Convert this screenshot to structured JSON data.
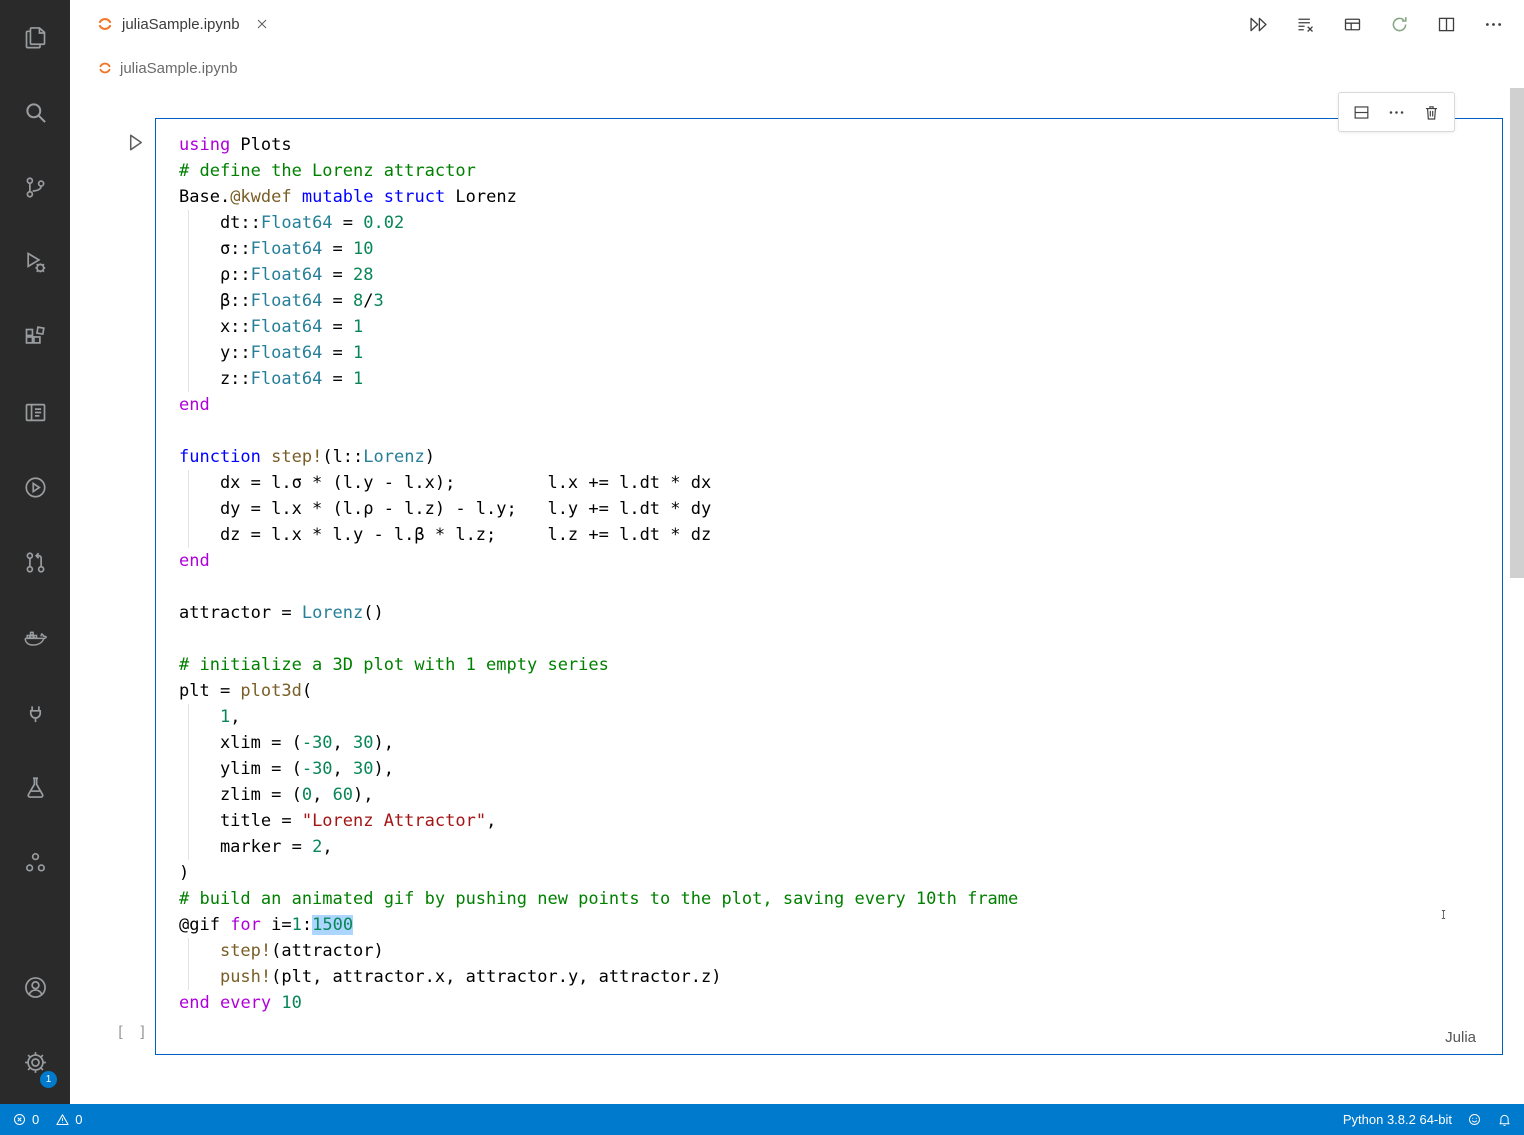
{
  "activity_bar": {
    "top_items": [
      "explorer",
      "search",
      "source-control",
      "run-debug",
      "extensions",
      "notebook",
      "run-circle",
      "pull-request",
      "docker",
      "remote",
      "test-flask",
      "organization"
    ],
    "bottom_items": [
      "account",
      "settings"
    ],
    "settings_badge": "1"
  },
  "tab_bar": {
    "tab": {
      "icon": "jupyter",
      "title": "juliaSample.ipynb"
    },
    "actions": [
      "run-all",
      "clear-outputs",
      "variables",
      "restart",
      "split-editor",
      "more-actions"
    ]
  },
  "breadcrumb": {
    "icon": "jupyter",
    "file": "juliaSample.ipynb"
  },
  "notebook": {
    "cell": {
      "toolbar": [
        "split-cell",
        "more-actions",
        "delete"
      ],
      "execution_count": "[ ]",
      "language": "Julia",
      "code_lines": [
        [
          [
            "k",
            "using"
          ],
          [
            "pl",
            " Plots"
          ]
        ],
        [
          [
            "co",
            "# define the Lorenz attractor"
          ]
        ],
        [
          [
            "pl",
            "Base."
          ],
          [
            "fn",
            "@kwdef"
          ],
          [
            "pl",
            " "
          ],
          [
            "kb",
            "mutable"
          ],
          [
            "pl",
            " "
          ],
          [
            "kb",
            "struct"
          ],
          [
            "pl",
            " Lorenz"
          ]
        ],
        [
          [
            "pl",
            "    dt::"
          ],
          [
            "ty",
            "Float64"
          ],
          [
            "pl",
            " = "
          ],
          [
            "nu",
            "0.02"
          ]
        ],
        [
          [
            "pl",
            "    σ::"
          ],
          [
            "ty",
            "Float64"
          ],
          [
            "pl",
            " = "
          ],
          [
            "nu",
            "10"
          ]
        ],
        [
          [
            "pl",
            "    ρ::"
          ],
          [
            "ty",
            "Float64"
          ],
          [
            "pl",
            " = "
          ],
          [
            "nu",
            "28"
          ]
        ],
        [
          [
            "pl",
            "    β::"
          ],
          [
            "ty",
            "Float64"
          ],
          [
            "pl",
            " = "
          ],
          [
            "nu",
            "8"
          ],
          [
            "pl",
            "/"
          ],
          [
            "nu",
            "3"
          ]
        ],
        [
          [
            "pl",
            "    x::"
          ],
          [
            "ty",
            "Float64"
          ],
          [
            "pl",
            " = "
          ],
          [
            "nu",
            "1"
          ]
        ],
        [
          [
            "pl",
            "    y::"
          ],
          [
            "ty",
            "Float64"
          ],
          [
            "pl",
            " = "
          ],
          [
            "nu",
            "1"
          ]
        ],
        [
          [
            "pl",
            "    z::"
          ],
          [
            "ty",
            "Float64"
          ],
          [
            "pl",
            " = "
          ],
          [
            "nu",
            "1"
          ]
        ],
        [
          [
            "k",
            "end"
          ]
        ],
        [],
        [
          [
            "kb",
            "function"
          ],
          [
            "pl",
            " "
          ],
          [
            "fn",
            "step!"
          ],
          [
            "pl",
            "(l::"
          ],
          [
            "ty",
            "Lorenz"
          ],
          [
            "pl",
            ")"
          ]
        ],
        [
          [
            "pl",
            "    dx = l.σ * (l.y - l.x);         l.x += l.dt * dx"
          ]
        ],
        [
          [
            "pl",
            "    dy = l.x * (l.ρ - l.z) - l.y;   l.y += l.dt * dy"
          ]
        ],
        [
          [
            "pl",
            "    dz = l.x * l.y - l.β * l.z;     l.z += l.dt * dz"
          ]
        ],
        [
          [
            "k",
            "end"
          ]
        ],
        [],
        [
          [
            "pl",
            "attractor = "
          ],
          [
            "ty",
            "Lorenz"
          ],
          [
            "pl",
            "()"
          ]
        ],
        [],
        [
          [
            "co",
            "# initialize a 3D plot with 1 empty series"
          ]
        ],
        [
          [
            "pl",
            "plt = "
          ],
          [
            "fn",
            "plot3d"
          ],
          [
            "pl",
            "("
          ]
        ],
        [
          [
            "pl",
            "    "
          ],
          [
            "nu",
            "1"
          ],
          [
            "pl",
            ","
          ]
        ],
        [
          [
            "pl",
            "    xlim = ("
          ],
          [
            "nu",
            "-30"
          ],
          [
            "pl",
            ", "
          ],
          [
            "nu",
            "30"
          ],
          [
            "pl",
            "),"
          ]
        ],
        [
          [
            "pl",
            "    ylim = ("
          ],
          [
            "nu",
            "-30"
          ],
          [
            "pl",
            ", "
          ],
          [
            "nu",
            "30"
          ],
          [
            "pl",
            "),"
          ]
        ],
        [
          [
            "pl",
            "    zlim = ("
          ],
          [
            "nu",
            "0"
          ],
          [
            "pl",
            ", "
          ],
          [
            "nu",
            "60"
          ],
          [
            "pl",
            "),"
          ]
        ],
        [
          [
            "pl",
            "    title = "
          ],
          [
            "st",
            "\"Lorenz Attractor\""
          ],
          [
            "pl",
            ","
          ]
        ],
        [
          [
            "pl",
            "    marker = "
          ],
          [
            "nu",
            "2"
          ],
          [
            "pl",
            ","
          ]
        ],
        [
          [
            "pl",
            ")"
          ]
        ],
        [
          [
            "co",
            "# build an animated gif by pushing new points to the plot, saving every 10th frame"
          ]
        ],
        [
          [
            "pl",
            "@gif "
          ],
          [
            "k",
            "for"
          ],
          [
            "pl",
            " i="
          ],
          [
            "nu",
            "1"
          ],
          [
            "pl",
            ":"
          ],
          [
            "sel",
            "1500"
          ]
        ],
        [
          [
            "pl",
            "    "
          ],
          [
            "fn",
            "step!"
          ],
          [
            "pl",
            "(attractor)"
          ]
        ],
        [
          [
            "pl",
            "    "
          ],
          [
            "fn",
            "push!"
          ],
          [
            "pl",
            "(plt, attractor.x, attractor.y, attractor.z)"
          ]
        ],
        [
          [
            "k",
            "end"
          ],
          [
            "pl",
            " "
          ],
          [
            "k",
            "every"
          ],
          [
            "pl",
            " "
          ],
          [
            "nu",
            "10"
          ]
        ]
      ]
    }
  },
  "status_bar": {
    "errors": "0",
    "warnings": "0",
    "interpreter": "Python 3.8.2 64-bit",
    "right_icons": [
      "feedback",
      "bell"
    ]
  },
  "colors": {
    "status_bar": "#007acc",
    "cell_border": "#0060c0",
    "selection": "#add6ff",
    "jupyter_orange": "#f37626"
  }
}
